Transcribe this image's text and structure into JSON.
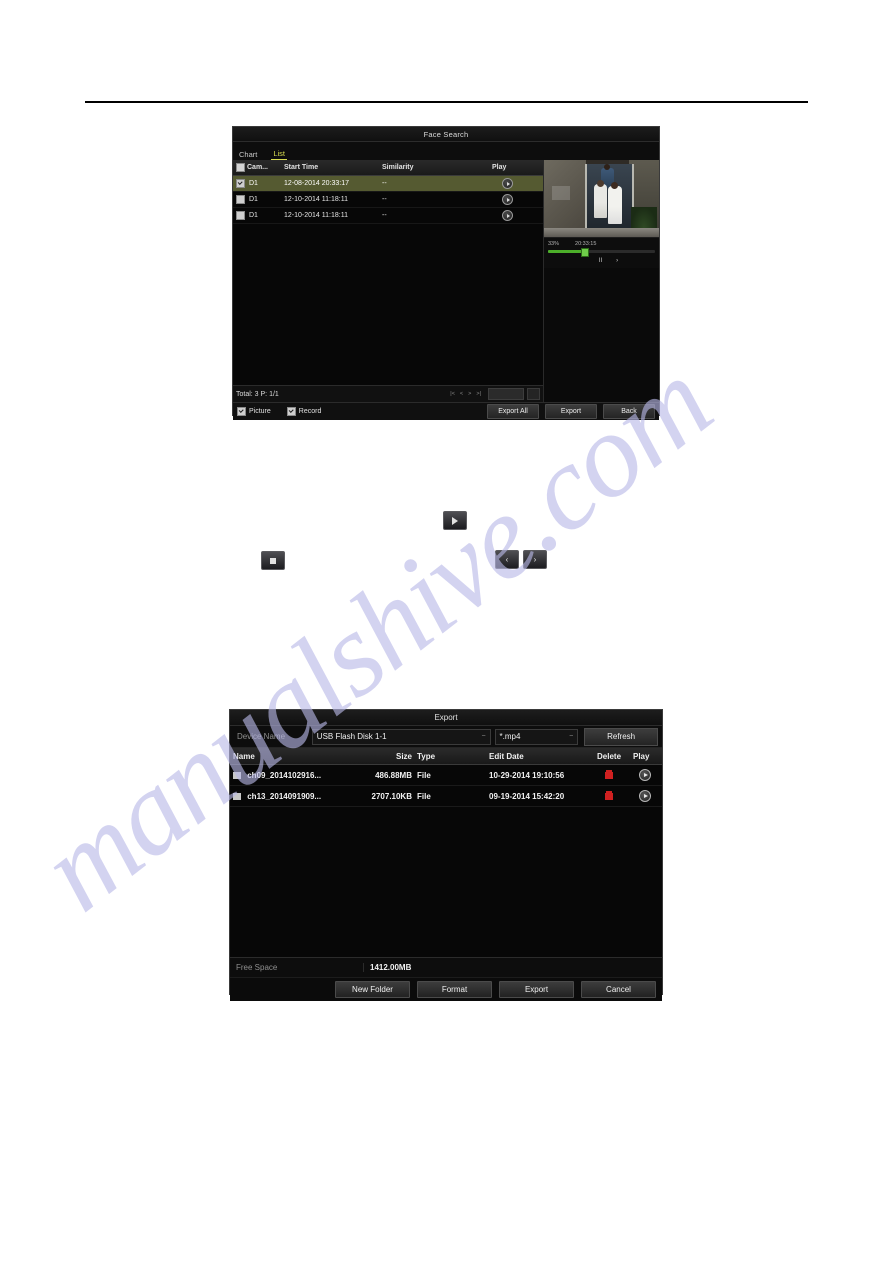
{
  "watermark": {
    "text": "manualshive.com",
    "color": "#b9b9e8"
  },
  "face_search": {
    "title": "Face Search",
    "tabs": [
      {
        "label": "Chart",
        "active": false
      },
      {
        "label": "List",
        "active": true
      }
    ],
    "columns": {
      "camera": "Cam...",
      "start_time": "Start Time",
      "similarity": "Similarity",
      "play": "Play"
    },
    "rows": [
      {
        "camera": "D1",
        "start_time": "12-08-2014 20:33:17",
        "similarity": "--",
        "checked": true,
        "selected": true
      },
      {
        "camera": "D1",
        "start_time": "12-10-2014 11:18:11",
        "similarity": "--",
        "checked": false,
        "selected": false
      },
      {
        "camera": "D1",
        "start_time": "12-10-2014 11:18:11",
        "similarity": "--",
        "checked": false,
        "selected": false
      }
    ],
    "pager": {
      "total_label": "Total: 3  P: 1/1",
      "first": "|<",
      "prev": "<",
      "next": ">",
      "last": ">|",
      "page_value": "",
      "go_label": "→"
    },
    "preview": {
      "progress_percent": "33%",
      "timestamp": "20:33:15",
      "progress_value": 33,
      "stop_label": "stop-icon",
      "pause_label": "II",
      "next_label": "›"
    },
    "footer": {
      "picture_label": "Picture",
      "picture_checked": true,
      "record_label": "Record",
      "record_checked": true,
      "export_all": "Export All",
      "export": "Export",
      "back": "Back"
    }
  },
  "standalone_buttons": {
    "play": "play-icon",
    "stop": "stop-icon",
    "prev": "‹",
    "next": "›"
  },
  "export": {
    "title": "Export",
    "device_name_label": "Device Name",
    "device_name_value": "USB Flash Disk 1-1",
    "file_type_value": "*.mp4",
    "refresh_label": "Refresh",
    "columns": {
      "name": "Name",
      "size": "Size",
      "type": "Type",
      "edit_date": "Edit Date",
      "delete": "Delete",
      "play": "Play"
    },
    "rows": [
      {
        "name": "ch09_2014102916...",
        "size": "486.88MB",
        "type": "File",
        "edit_date": "10-29-2014 19:10:56"
      },
      {
        "name": "ch13_2014091909...",
        "size": "2707.10KB",
        "type": "File",
        "edit_date": "09-19-2014 15:42:20"
      }
    ],
    "free_space_label": "Free Space",
    "free_space_value": "1412.00MB",
    "buttons": {
      "new_folder": "New Folder",
      "format": "Format",
      "export": "Export",
      "cancel": "Cancel"
    }
  }
}
